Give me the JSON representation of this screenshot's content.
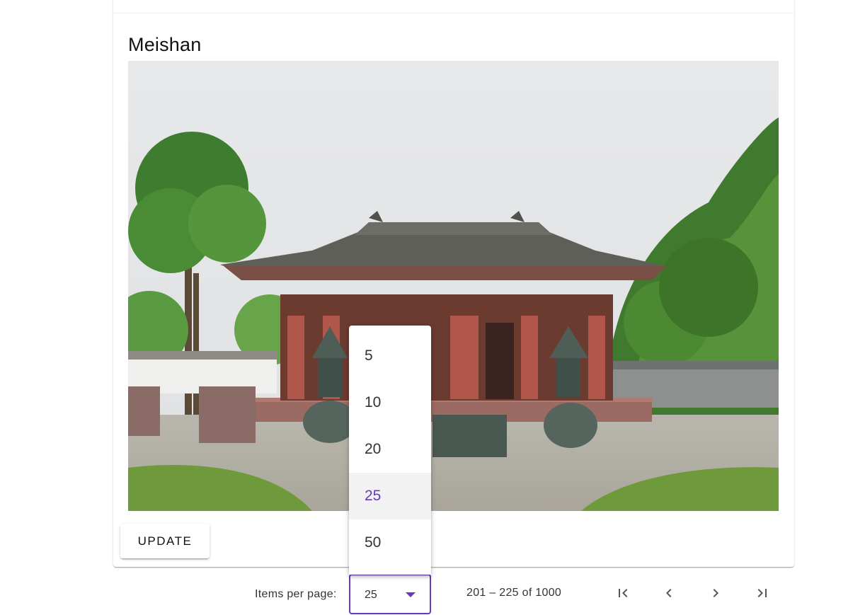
{
  "card": {
    "title": "Meishan",
    "update_label": "UPDATE"
  },
  "photo": {
    "description_icon": "temple-photo"
  },
  "paginator": {
    "items_per_page_label": "Items per page:",
    "page_size_value": "25",
    "range_label": "201 – 225 of 1000",
    "first_icon": "first-page-icon",
    "prev_icon": "chevron-left-icon",
    "next_icon": "chevron-right-icon",
    "last_icon": "last-page-icon"
  },
  "dropdown": {
    "options": [
      "5",
      "10",
      "20",
      "25",
      "50"
    ],
    "selected": "25"
  },
  "colors": {
    "accent": "#673ab7",
    "selected_bg": "#f2f2f2"
  }
}
